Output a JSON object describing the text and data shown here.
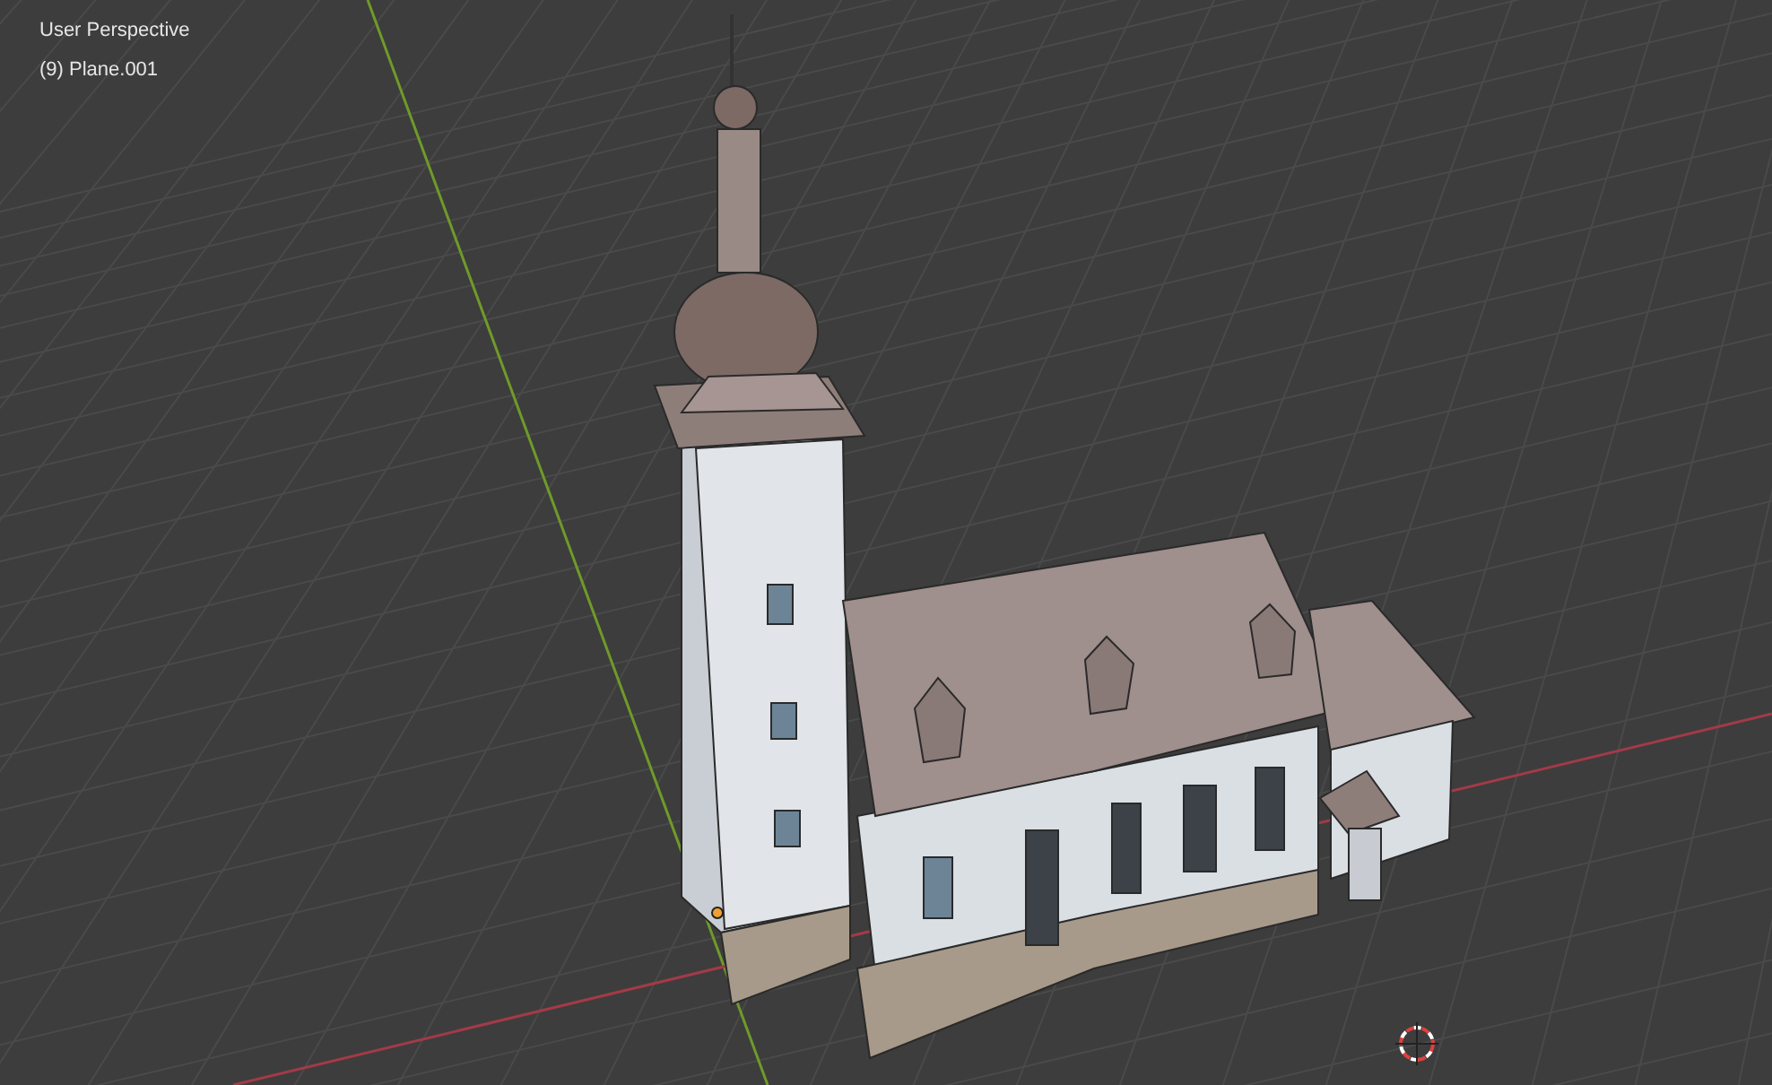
{
  "viewport": {
    "view_name": "User Perspective",
    "active_object": "(9) Plane.001"
  }
}
